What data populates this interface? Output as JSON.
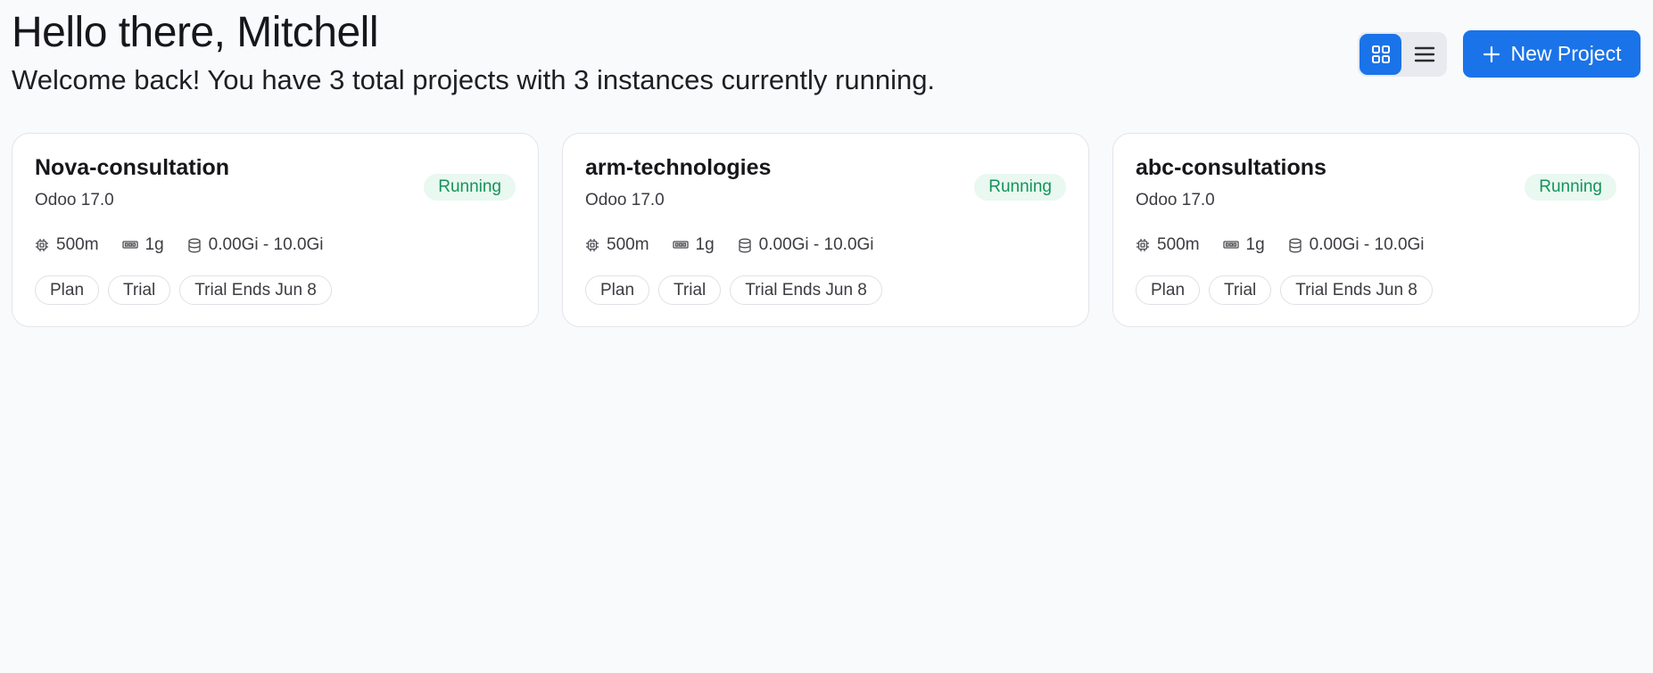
{
  "header": {
    "greeting": "Hello there, Mitchell",
    "subtitle": "Welcome back! You have 3 total projects with 3 instances currently running."
  },
  "toolbar": {
    "grid_view_icon": "grid-icon",
    "list_view_icon": "list-icon",
    "active_view": "grid",
    "new_project_label": "New Project",
    "new_project_icon": "plus-icon"
  },
  "colors": {
    "accent": "#1a73e8",
    "running_text": "#15935a",
    "running_bg": "#e9f8f0"
  },
  "projects": [
    {
      "name": "Nova-consultation",
      "version": "Odoo 17.0",
      "status": "Running",
      "cpu": "500m",
      "memory": "1g",
      "storage": "0.00Gi - 10.0Gi",
      "tags": [
        "Plan",
        "Trial",
        "Trial Ends Jun 8"
      ]
    },
    {
      "name": "arm-technologies",
      "version": "Odoo 17.0",
      "status": "Running",
      "cpu": "500m",
      "memory": "1g",
      "storage": "0.00Gi - 10.0Gi",
      "tags": [
        "Plan",
        "Trial",
        "Trial Ends Jun 8"
      ]
    },
    {
      "name": "abc-consultations",
      "version": "Odoo 17.0",
      "status": "Running",
      "cpu": "500m",
      "memory": "1g",
      "storage": "0.00Gi - 10.0Gi",
      "tags": [
        "Plan",
        "Trial",
        "Trial Ends Jun 8"
      ]
    }
  ]
}
